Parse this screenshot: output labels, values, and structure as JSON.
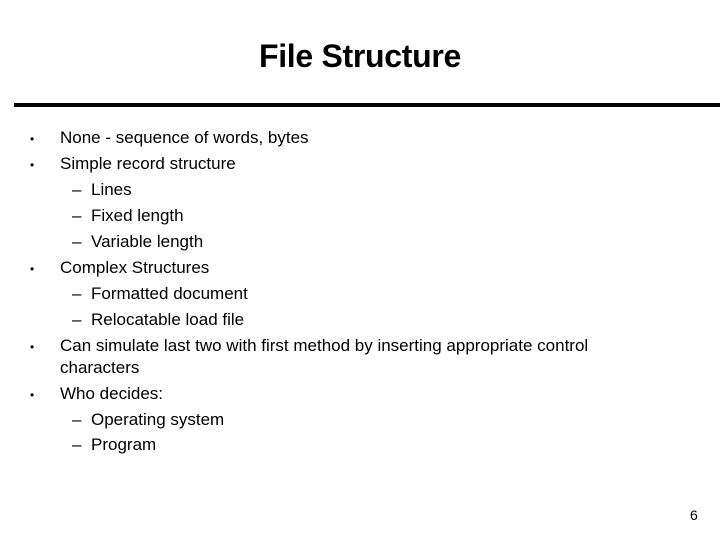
{
  "slide": {
    "title": "File Structure",
    "page_number": "6",
    "bullet_glyph": "•",
    "dash_glyph": "–",
    "items": [
      {
        "text": "None - sequence of words, bytes"
      },
      {
        "text": "Simple record structure",
        "sub": [
          "Lines",
          "Fixed length",
          "Variable length"
        ]
      },
      {
        "text": "Complex Structures",
        "sub": [
          "Formatted document",
          "Relocatable load file"
        ]
      },
      {
        "text_line1": "Can simulate last two with first method by inserting appropriate control",
        "text_line2": "characters"
      },
      {
        "text": "Who decides:",
        "sub": [
          "Operating system",
          "Program"
        ]
      }
    ]
  }
}
